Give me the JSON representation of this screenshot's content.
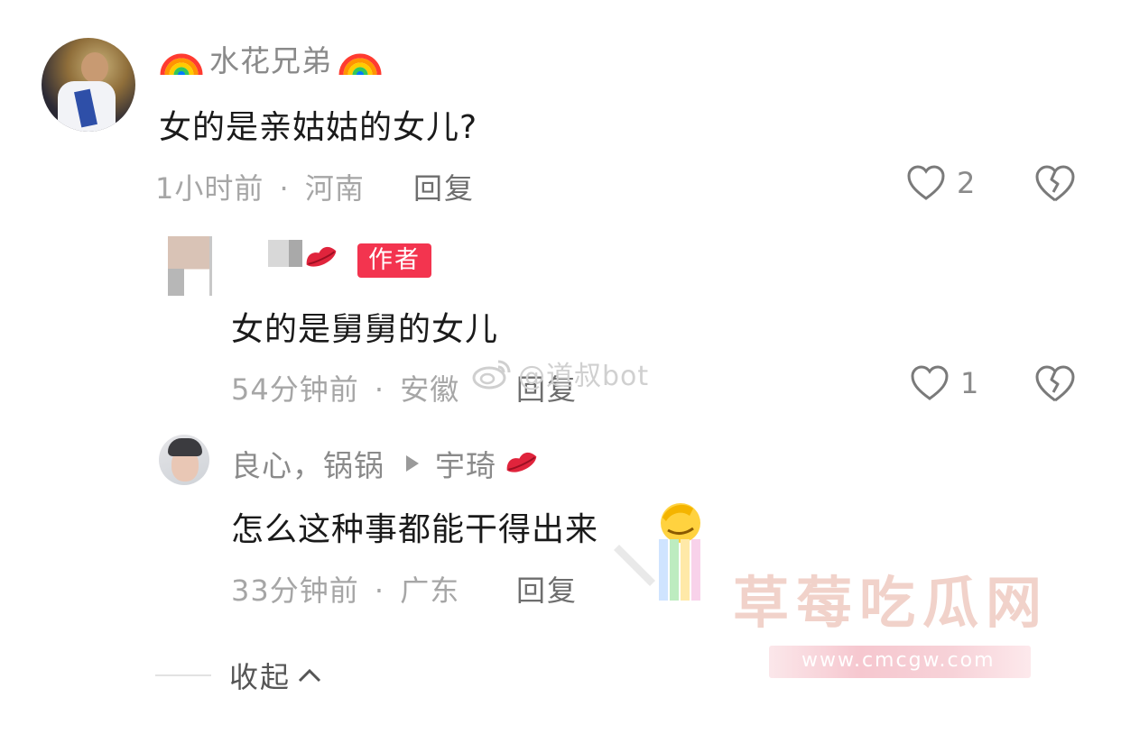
{
  "comment_main": {
    "username": "水花兄弟",
    "text": "女的是亲姑姑的女儿?",
    "time": "1小时前",
    "location": "河南",
    "reply_label": "回复",
    "likes": "2"
  },
  "reply_author": {
    "badge": "作者",
    "text": "女的是舅舅的女儿",
    "time": "54分钟前",
    "location": "安徽",
    "reply_label": "回复",
    "likes": "1"
  },
  "reply_user": {
    "username": "良心，锅锅",
    "reply_to": "宇琦",
    "text": "怎么这种事都能干得出来",
    "time": "33分钟前",
    "location": "广东",
    "reply_label": "回复"
  },
  "collapse_label": "收起",
  "watermarks": {
    "weibo": "@道叔bot",
    "site_title": "草莓吃瓜网",
    "site_url": "www.cmcgw.com"
  },
  "separator": "·",
  "colors": {
    "author_badge": "#f3344f",
    "meta_text": "#a6a6a6",
    "content_text": "#1a1a1a"
  },
  "icons": [
    "rainbow-icon",
    "heart-outline-icon",
    "broken-heart-icon",
    "lips-icon",
    "play-arrow-icon",
    "chevron-up-icon",
    "facepalm-emoji-icon",
    "weibo-logo-icon"
  ]
}
